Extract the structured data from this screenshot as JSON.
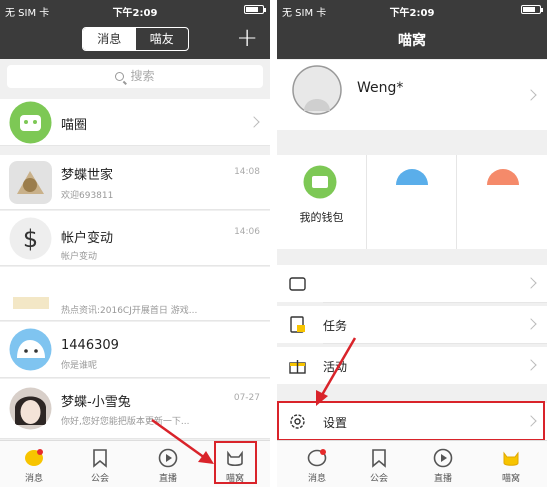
{
  "status": {
    "carrier": "无 SIM 卡",
    "time": "下午2:09"
  },
  "left": {
    "seg_messages": "消息",
    "seg_friends": "喵友",
    "plus": "+",
    "search_placeholder": "搜索",
    "circle_label": "喵圈",
    "chats": [
      {
        "name": "梦蝶世家",
        "message": "欢迎693811",
        "time": "14:08"
      },
      {
        "name": "帐户变动",
        "message": "帐户变动",
        "time": "14:06"
      },
      {
        "name": "",
        "message": "热点资讯:2016CJ开展首日  游戏...",
        "time": ""
      },
      {
        "name": "1446309",
        "message": "你是谁呢",
        "time": ""
      },
      {
        "name": "梦蝶-小雪兔",
        "message": "你好,您好您能把版本更新一下...",
        "time": "07-27"
      }
    ],
    "tabs": [
      "消息",
      "公会",
      "直播",
      "喵窝"
    ]
  },
  "right": {
    "title": "喵窝",
    "username": "Weng*",
    "wallet": "我的钱包",
    "menu": [
      "任务",
      "活动",
      "设置"
    ],
    "tabs": [
      "消息",
      "公会",
      "直播",
      "喵窝"
    ]
  },
  "colors": {
    "accent": "#f7c400",
    "highlight": "#d9232a",
    "header": "#3b3b3b"
  }
}
